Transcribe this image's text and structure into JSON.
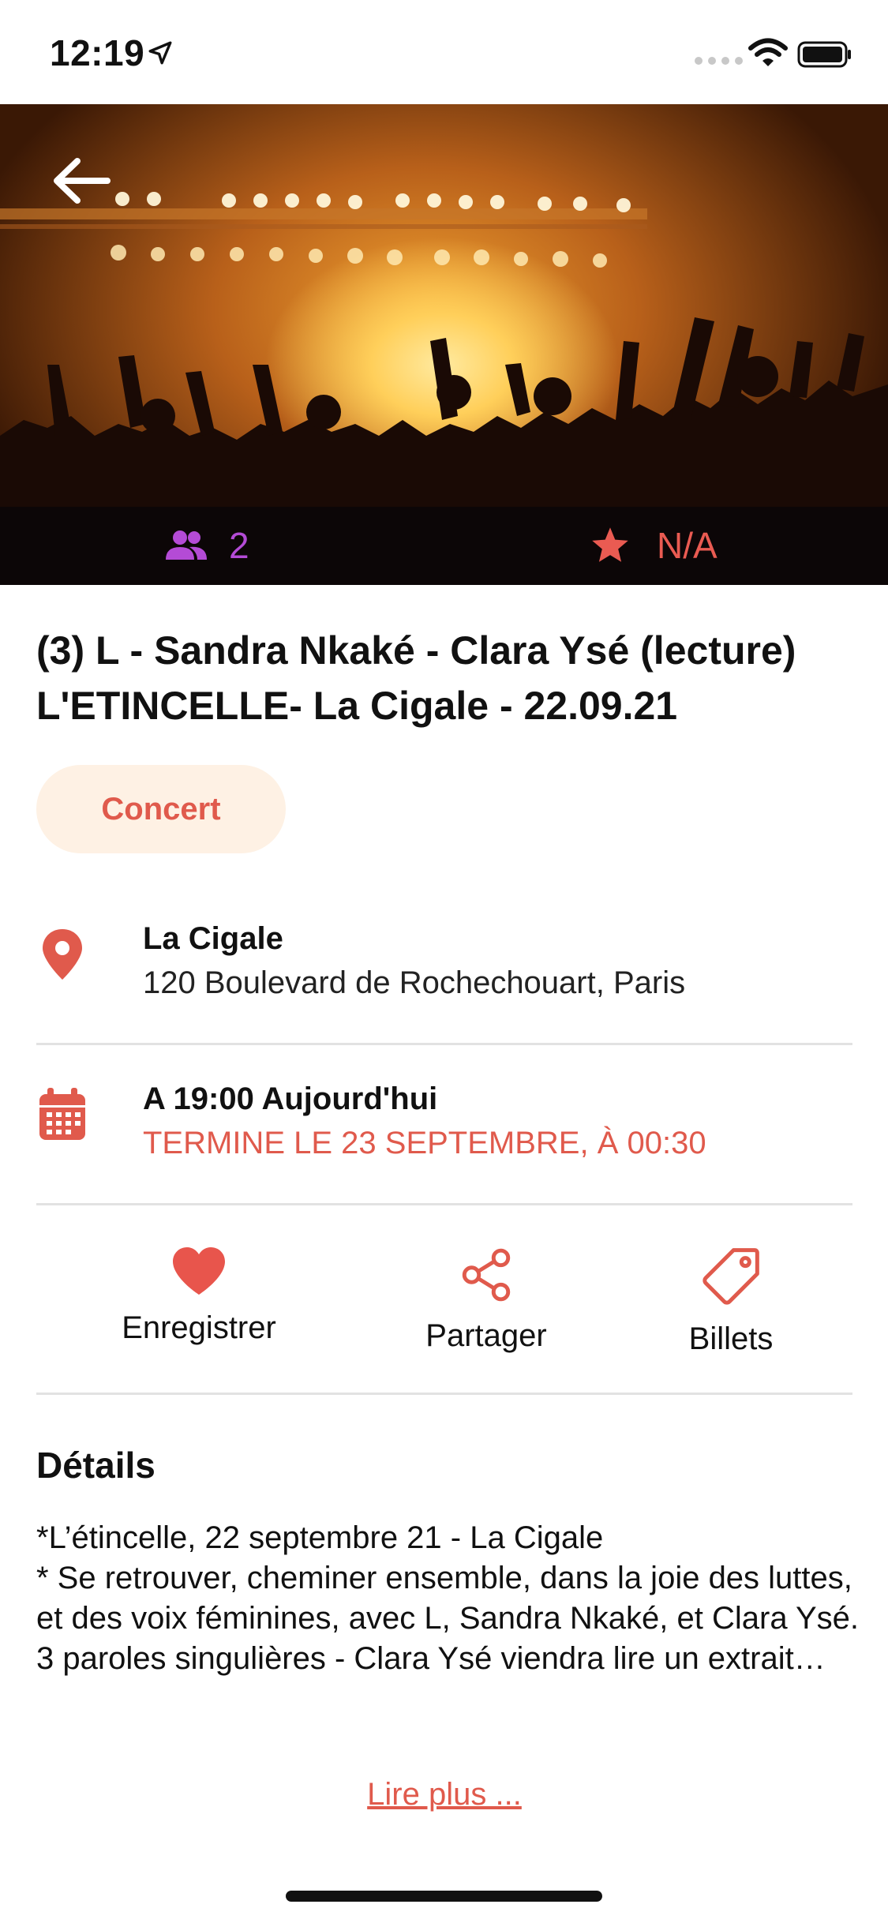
{
  "status_bar": {
    "time": "12:19"
  },
  "hero": {
    "attendees": "2",
    "rating": "N/A"
  },
  "event": {
    "title": "(3) L - Sandra Nkaké - Clara Ysé (lecture) L'ETINCELLE- La Cigale - 22.09.21",
    "category": "Concert"
  },
  "location": {
    "name": "La Cigale",
    "address": "120 Boulevard de Rochechouart, Paris"
  },
  "schedule": {
    "time": "A 19:00 Aujourd'hui",
    "ends": "TERMINE LE 23 SEPTEMBRE, À 00:30"
  },
  "actions": {
    "save_label": "Enregistrer",
    "share_label": "Partager",
    "tickets_label": "Billets"
  },
  "details": {
    "heading": "Détails",
    "text": "*L’étincelle, 22 septembre 21 - La Cigale\n* Se retrouver, cheminer ensemble, dans la joie des luttes, et des voix féminines, avec L, Sandra Nkaké, et Clara Ysé.\n3 paroles singulières - Clara Ysé viendra lire un extrait…",
    "read_more": "Lire plus ..."
  },
  "colors": {
    "accent": "#e05a4c",
    "purple": "#b44bd6",
    "chip_bg": "#fef1e4",
    "divider": "#e2e2e2"
  },
  "icons": [
    "location-arrow-icon",
    "wifi-icon",
    "battery-icon",
    "back-arrow-icon",
    "people-icon",
    "star-icon",
    "map-pin-icon",
    "calendar-icon",
    "heart-icon",
    "share-icon",
    "tag-icon"
  ]
}
